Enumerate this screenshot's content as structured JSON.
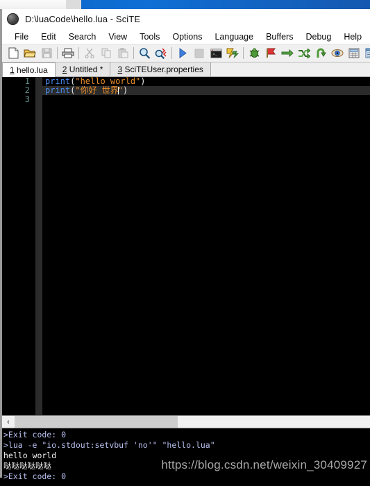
{
  "window": {
    "title": "D:\\luaCode\\hello.lua - SciTE",
    "app_icon": "sphere-icon"
  },
  "menubar": {
    "items": [
      {
        "label": "File",
        "name": "menu-file"
      },
      {
        "label": "Edit",
        "name": "menu-edit"
      },
      {
        "label": "Search",
        "name": "menu-search"
      },
      {
        "label": "View",
        "name": "menu-view"
      },
      {
        "label": "Tools",
        "name": "menu-tools"
      },
      {
        "label": "Options",
        "name": "menu-options"
      },
      {
        "label": "Language",
        "name": "menu-language"
      },
      {
        "label": "Buffers",
        "name": "menu-buffers"
      },
      {
        "label": "Debug",
        "name": "menu-debug"
      },
      {
        "label": "Help",
        "name": "menu-help"
      }
    ]
  },
  "toolbar": {
    "buttons": [
      {
        "icon": "new-file-icon",
        "enabled": true
      },
      {
        "icon": "open-folder-icon",
        "enabled": true
      },
      {
        "icon": "save-icon",
        "enabled": false
      },
      {
        "sep": true
      },
      {
        "icon": "print-icon",
        "enabled": true
      },
      {
        "sep": true
      },
      {
        "icon": "cut-scissors-icon",
        "enabled": false
      },
      {
        "icon": "copy-icon",
        "enabled": false
      },
      {
        "icon": "paste-icon",
        "enabled": false
      },
      {
        "sep": true
      },
      {
        "icon": "find-magnifier-icon",
        "enabled": true
      },
      {
        "icon": "replace-magnifier-icon",
        "enabled": true
      },
      {
        "sep": true
      },
      {
        "icon": "run-play-icon",
        "enabled": true
      },
      {
        "icon": "stop-square-icon",
        "enabled": false
      },
      {
        "icon": "console-window-icon",
        "enabled": true
      },
      {
        "icon": "compile-lightning-icon",
        "enabled": true
      },
      {
        "sep": true
      },
      {
        "icon": "debug-bug-icon",
        "enabled": true
      },
      {
        "icon": "stop-debug-flag-icon",
        "enabled": true
      },
      {
        "icon": "step-over-arrow-icon",
        "enabled": true
      },
      {
        "icon": "step-into-arrow-icon",
        "enabled": true
      },
      {
        "icon": "step-out-arrow-icon",
        "enabled": true
      },
      {
        "icon": "watch-eye-icon",
        "enabled": true
      },
      {
        "icon": "variables-grid-icon",
        "enabled": true
      },
      {
        "icon": "output-window-icon",
        "enabled": true
      }
    ]
  },
  "tabs": [
    {
      "num": "1",
      "label": "hello.lua",
      "active": true,
      "modified": false
    },
    {
      "num": "2",
      "label": "Untitled *",
      "active": false,
      "modified": true
    },
    {
      "num": "3",
      "label": "SciTEUser.properties",
      "active": false,
      "modified": false
    }
  ],
  "editor": {
    "line_numbers": [
      "1",
      "2",
      "3"
    ],
    "lines": [
      {
        "current": false,
        "tokens": [
          {
            "text": "print",
            "type": "kw"
          },
          {
            "text": "(",
            "type": "punc"
          },
          {
            "text": "\"hello world\"",
            "type": "str"
          },
          {
            "text": ")",
            "type": "punc"
          }
        ]
      },
      {
        "current": true,
        "caret_after": 3,
        "tokens": [
          {
            "text": "print",
            "type": "kw"
          },
          {
            "text": "(",
            "type": "punc"
          },
          {
            "text": "\"你好 世界",
            "type": "str"
          },
          {
            "text": "\"",
            "type": "str"
          },
          {
            "text": ")",
            "type": "punc"
          }
        ]
      },
      {
        "current": false,
        "tokens": []
      }
    ]
  },
  "hscrollbar": {
    "left_arrow": "‹"
  },
  "output": {
    "lines": [
      {
        "text": ">Exit code: 0",
        "type": "cmd"
      },
      {
        "text": ">lua -e \"io.stdout:setvbuf 'no'\" \"hello.lua\"",
        "type": "cmd"
      },
      {
        "text": "hello world",
        "type": "out"
      },
      {
        "text": "哒哒哒哒哒哒",
        "type": "out"
      },
      {
        "text": ">Exit code: 0",
        "type": "cmd"
      }
    ],
    "watermark": "https://blog.csdn.net/weixin_30409927"
  },
  "colors": {
    "keyword": "#4a8cf0",
    "string": "#e88c28",
    "punctuation": "#e8e8e8",
    "line_number": "#5f8f88",
    "editor_bg": "#000000",
    "current_line": "#2b2b2b",
    "output_cmd": "#b9c0f0",
    "output_text": "#f2f2f2",
    "desktop": "#0f6fd4"
  }
}
